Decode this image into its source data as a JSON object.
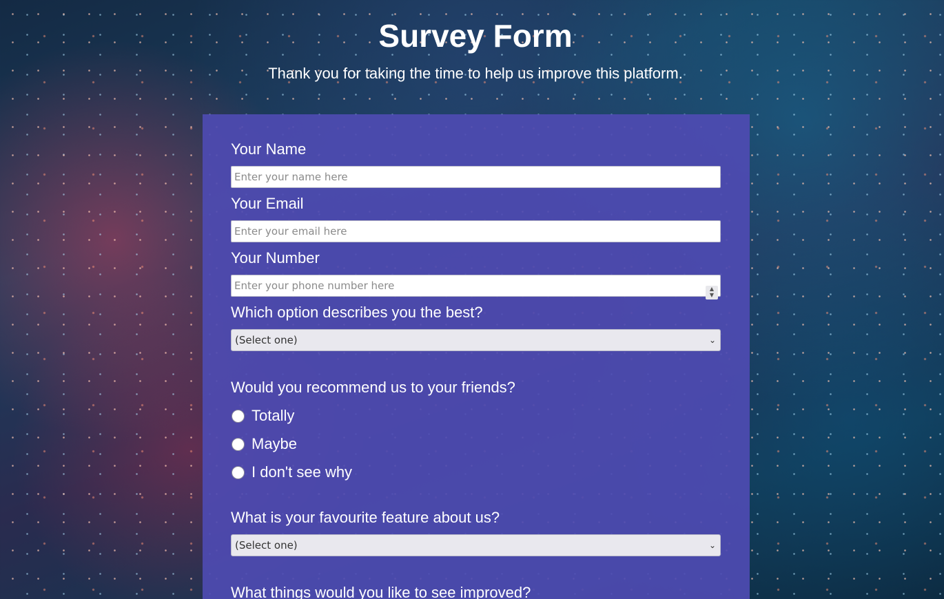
{
  "header": {
    "title": "Survey Form",
    "description": "Thank you for taking the time to help us improve this platform."
  },
  "form": {
    "name": {
      "label": "Your Name",
      "placeholder": "Enter your name here"
    },
    "email": {
      "label": "Your Email",
      "placeholder": "Enter your email here"
    },
    "number": {
      "label": "Your Number",
      "placeholder": "Enter your phone number here"
    },
    "role": {
      "label": "Which option describes you the best?",
      "selected": "(Select one)"
    },
    "recommend": {
      "label": "Would you recommend us to your friends?",
      "options": [
        "Totally",
        "Maybe",
        "I don't see why"
      ]
    },
    "feature": {
      "label": "What is your favourite feature about us?",
      "selected": "(Select one)"
    },
    "improve": {
      "label": "What things would you like to see improved?"
    }
  },
  "colors": {
    "panel": "#4e4bb2",
    "text": "#ffffff"
  }
}
